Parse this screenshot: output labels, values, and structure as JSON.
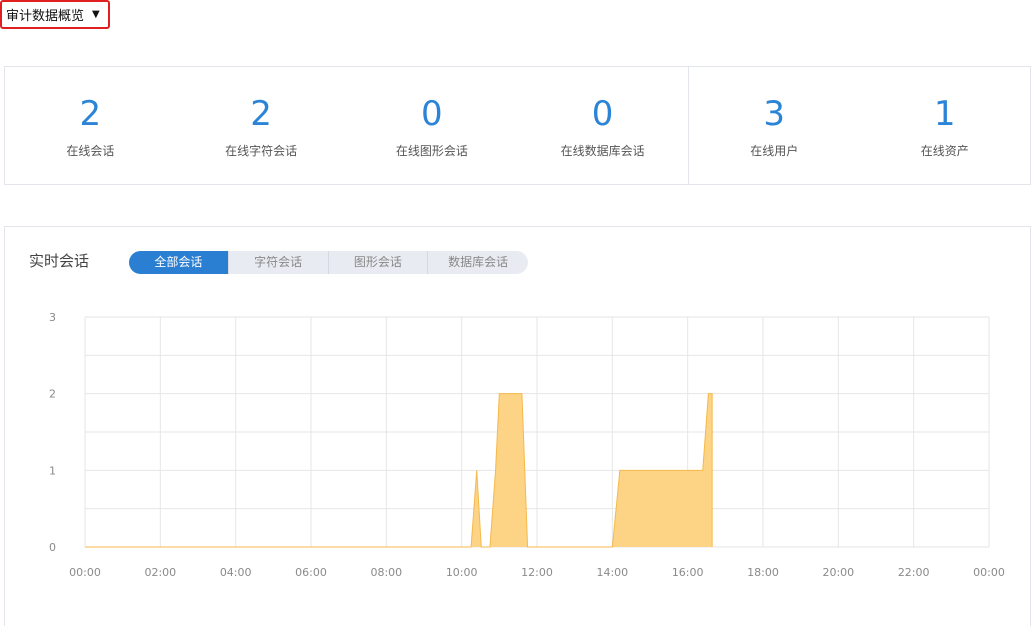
{
  "header": {
    "dropdown_label": "审计数据概览"
  },
  "stats": {
    "sessions": [
      {
        "value": "2",
        "label": "在线会话"
      },
      {
        "value": "2",
        "label": "在线字符会话"
      },
      {
        "value": "0",
        "label": "在线图形会话"
      },
      {
        "value": "0",
        "label": "在线数据库会话"
      }
    ],
    "assets": [
      {
        "value": "3",
        "label": "在线用户"
      },
      {
        "value": "1",
        "label": "在线资产"
      }
    ]
  },
  "realtime": {
    "title": "实时会话",
    "tabs": [
      {
        "label": "全部会话",
        "active": true
      },
      {
        "label": "字符会话",
        "active": false
      },
      {
        "label": "图形会话",
        "active": false
      },
      {
        "label": "数据库会话",
        "active": false
      }
    ]
  },
  "colors": {
    "accent": "#2b84d6",
    "series_fill": "#fdd385",
    "series_line": "#f5b94a",
    "grid": "#e6e6e6"
  },
  "chart_data": {
    "type": "area",
    "x_ticks": [
      "00:00",
      "02:00",
      "04:00",
      "06:00",
      "08:00",
      "10:00",
      "12:00",
      "14:00",
      "16:00",
      "18:00",
      "20:00",
      "22:00",
      "00:00"
    ],
    "y_ticks": [
      "0",
      "1",
      "2",
      "3"
    ],
    "ylim": [
      0,
      3
    ],
    "xlim_hours": [
      0,
      24
    ],
    "grid": true,
    "series": [
      {
        "points": [
          [
            0,
            0
          ],
          [
            10.25,
            0
          ],
          [
            10.4,
            1
          ],
          [
            10.52,
            0
          ],
          [
            10.75,
            0
          ],
          [
            10.9,
            1
          ],
          [
            11.0,
            2
          ],
          [
            11.6,
            2
          ],
          [
            11.75,
            0
          ],
          [
            14.0,
            0
          ],
          [
            14.2,
            1
          ],
          [
            16.4,
            1
          ],
          [
            16.55,
            2
          ],
          [
            16.65,
            2
          ],
          [
            16.65,
            0
          ]
        ]
      }
    ]
  }
}
